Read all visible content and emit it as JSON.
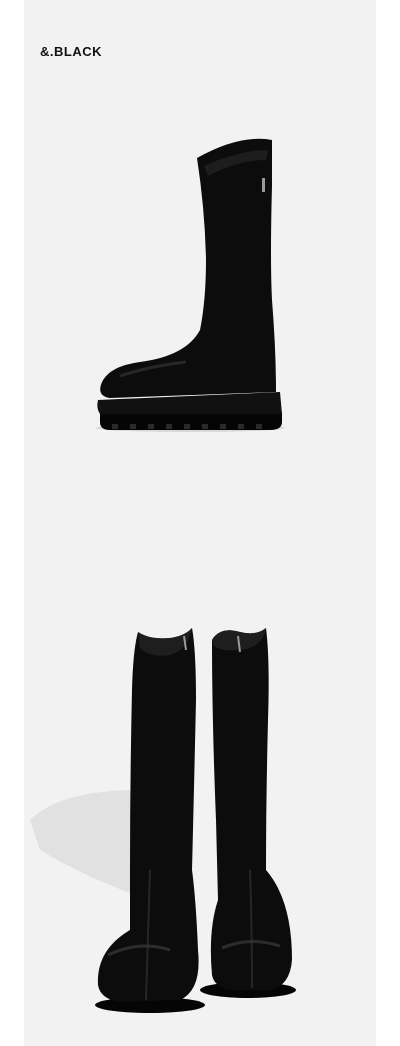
{
  "product": {
    "color_label": "&.BLACK",
    "image_subject": "boots-icon"
  },
  "colors": {
    "background": "#ffffff",
    "panel": "#f2f2f2",
    "boot": "#0c0c0c",
    "label": "#111111"
  }
}
